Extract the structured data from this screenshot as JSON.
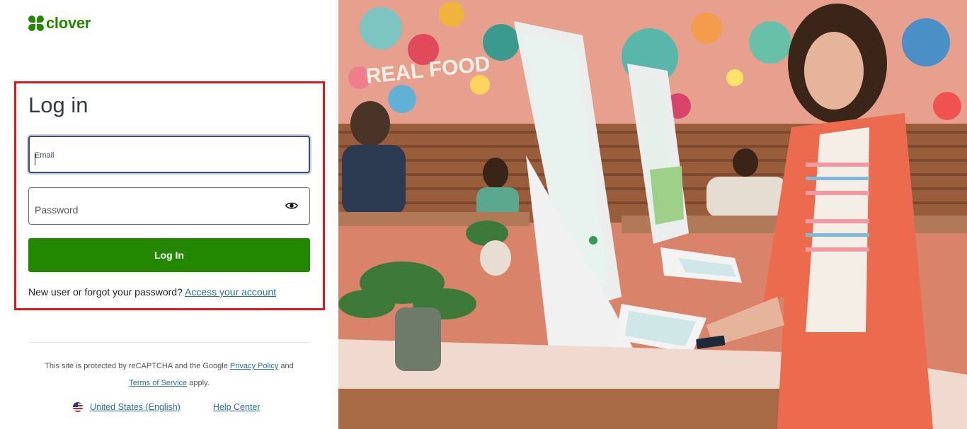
{
  "brand": {
    "name": "clover",
    "color": "#228800"
  },
  "login": {
    "title": "Log in",
    "email_label": "Email",
    "password_label": "Password",
    "submit_label": "Log In",
    "help_text": "New user or forgot your password?",
    "help_link": "Access your account"
  },
  "recaptcha": {
    "text_before": "This site is protected by reCAPTCHA and the Google",
    "privacy_link": "Privacy Policy",
    "and_text": "and",
    "terms_link": "Terms of Service",
    "apply_text": "apply."
  },
  "footer": {
    "locale": "United States (English)",
    "help_center": "Help Center"
  },
  "icons": {
    "eye": "eye-icon",
    "flag": "us-flag-icon"
  },
  "colors": {
    "primary_button": "#228800",
    "link": "#2d6ea8",
    "highlight": "#e0181d"
  }
}
